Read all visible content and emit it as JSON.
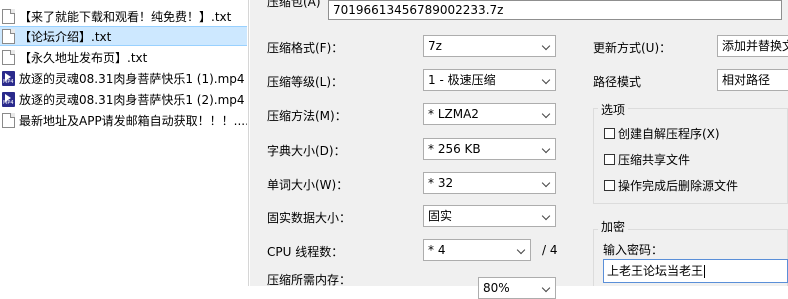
{
  "files": [
    {
      "name": "【来了就能下载和观看！纯免费！】.txt",
      "type": "txt",
      "selected": false
    },
    {
      "name": "【论坛介绍】.txt",
      "type": "txt",
      "selected": true
    },
    {
      "name": "【永久地址发布页】.txt",
      "type": "txt",
      "selected": false
    },
    {
      "name": "放逐的灵魂08.31肉身菩萨快乐1 (1).mp4",
      "type": "mp4",
      "selected": false
    },
    {
      "name": "放逐的灵魂08.31肉身菩萨快乐1 (2).mp4",
      "type": "mp4",
      "selected": false
    },
    {
      "name": "最新地址及APP请发邮箱自动获取！！！....",
      "type": "txt",
      "selected": false
    }
  ],
  "mp4_badge": "MP4",
  "archive": {
    "label": "压缩包(A)",
    "value": "70196613456789002233.7z"
  },
  "format": {
    "label": "压缩格式(F)：",
    "value": "7z"
  },
  "level": {
    "label": "压缩等级(L)：",
    "value": "1 - 极速压缩"
  },
  "method": {
    "label": "压缩方法(M)：",
    "value": "* LZMA2"
  },
  "dict": {
    "label": "字典大小(D)：",
    "value": "* 256 KB"
  },
  "word": {
    "label": "单词大小(W)：",
    "value": "* 32"
  },
  "solid": {
    "label": "固实数据大小：",
    "value": "固实"
  },
  "threads": {
    "label": "CPU 线程数：",
    "value": "* 4",
    "max": "/ 4"
  },
  "memory": {
    "label": "压缩所需内存：",
    "value": "80%"
  },
  "update_mode": {
    "label": "更新方式(U)：",
    "value": "添加并替换文"
  },
  "path_mode": {
    "label": "路径模式",
    "value": "相对路径"
  },
  "options": {
    "title": "选项",
    "sfx": "创建自解压程序(X)",
    "shared": "压缩共享文件",
    "delete": "操作完成后删除源文件"
  },
  "encryption": {
    "title": "加密",
    "password_label": "输入密码：",
    "password_value": "上老王论坛当老王"
  },
  "colors": {
    "selection": "#cde8ff",
    "panel": "#f0f0f0",
    "focus_border": "#5a8fd8"
  }
}
